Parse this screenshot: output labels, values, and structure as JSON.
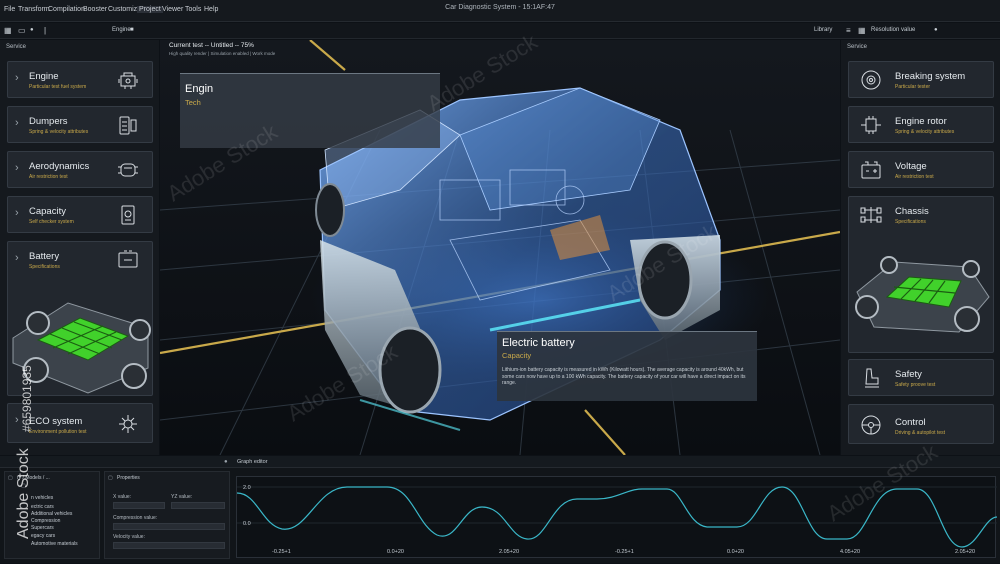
{
  "menubar": {
    "items": [
      "File",
      "Transform",
      "Compilation",
      "Booster",
      "Customize",
      "Project",
      "Viewer",
      "Tools",
      "Help"
    ],
    "title": "Car Diagnostic System - 15:1AF:47"
  },
  "toolbar": {
    "center_label": "Engine",
    "library_label": "Library",
    "resolution_label": "Resolution value"
  },
  "left_panel": {
    "header": "Service",
    "cards": [
      {
        "title": "Engine",
        "subtitle": "Particular test fuel system",
        "icon": "engine-icon"
      },
      {
        "title": "Dumpers",
        "subtitle": "Spring & velocity attributes",
        "icon": "damper-icon"
      },
      {
        "title": "Aerodynamics",
        "subtitle": "Air restriction test",
        "icon": "car-top-icon"
      },
      {
        "title": "Capacity",
        "subtitle": "Self checker system",
        "icon": "capacity-icon"
      },
      {
        "title": "Battery",
        "subtitle": "Specifications",
        "icon": "battery-icon"
      },
      {
        "title": "ECO system",
        "subtitle": "Environment pollution test",
        "icon": "eco-icon"
      }
    ]
  },
  "right_panel": {
    "header": "Service",
    "cards": [
      {
        "title": "Breaking system",
        "subtitle": "Particular tester",
        "icon": "brake-disc-icon"
      },
      {
        "title": "Engine rotor",
        "subtitle": "Spring & velocity attributes",
        "icon": "rotor-icon"
      },
      {
        "title": "Voltage",
        "subtitle": "Air restriction test",
        "icon": "car-battery-icon"
      },
      {
        "title": "Chassis",
        "subtitle": "Specifications",
        "icon": "chassis-icon"
      },
      {
        "title": "Safety",
        "subtitle": "Safety proove test",
        "icon": "seat-icon"
      },
      {
        "title": "Control",
        "subtitle": "Driving & autopilot test",
        "icon": "steering-wheel-icon"
      }
    ]
  },
  "viewport": {
    "current_test": "Current test -- Untitled -- 75%",
    "status_line": "High quality render | Simulation enabled | Work mode",
    "engine_popup": {
      "title": "Engin",
      "subtitle": "Tech"
    },
    "battery_popup": {
      "title": "Electric battery",
      "subtitle": "Capacity",
      "body": "Lithium-ion battery capacity is measured in kWh (Kilowatt hours). The average capacity is around 40kWh, but some cars now have up to a 100 kWh capacity. The battery capacity of your car will have a direct impact on its range."
    }
  },
  "bottom": {
    "tree_header": "ry / Models / ...",
    "tree_items": [
      "n vehicles",
      "ectric cars",
      "Additional vehicles",
      "Compression",
      "Supercars",
      "egacy cars",
      "Automotive materials"
    ],
    "properties_header": "Properties",
    "x_label": "X value:",
    "yz_label": "YZ value:",
    "compression_label": "Compression value:",
    "velocity_label": "Velocity value:",
    "graph_title": "Graph editor",
    "graph_y_labels": [
      "2.0",
      "0.0"
    ],
    "graph_x_labels": [
      "-0.25+1",
      "0.0+20",
      "2.05+20",
      "-0.25+1",
      "0.0+20",
      "4.05+20",
      "2.05+20"
    ]
  },
  "watermark": {
    "text": "Adobe Stock",
    "side_id": "#659801935"
  },
  "colors": {
    "accent_gold": "#c9a94a",
    "battery_green": "#41d12b",
    "car_blue": "#4a8fe0",
    "curve": "#3ab7c8"
  }
}
